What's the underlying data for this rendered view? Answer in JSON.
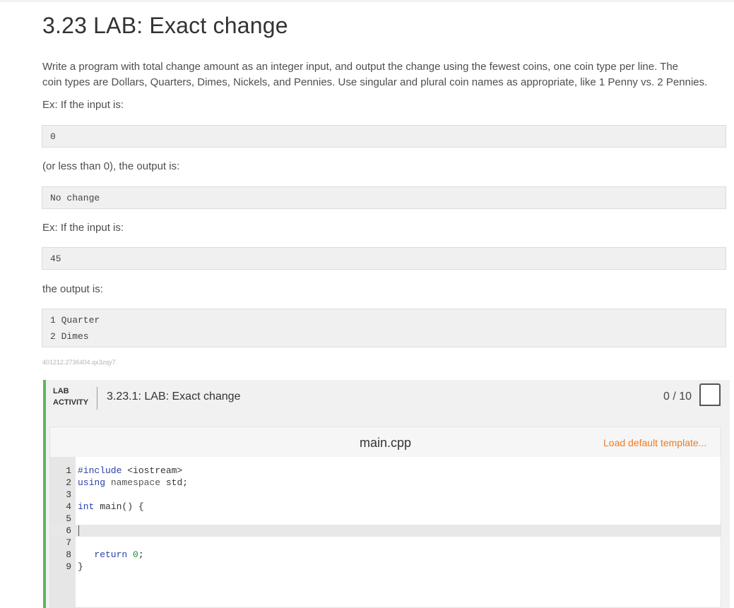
{
  "page": {
    "title": "3.23 LAB: Exact change",
    "description": "Write a program with total change amount as an integer input, and output the change using the fewest coins, one coin type per line. The coin types are Dollars, Quarters, Dimes, Nickels, and Pennies. Use singular and plural coin names as appropriate, like 1 Penny vs. 2 Pennies.",
    "description_line1": "Write a program with total change amount as an integer input, and output the change using the fewest coins, one coin type per line. The",
    "description_line2": "coin types are Dollars, Quarters, Dimes, Nickels, and Pennies. Use singular and plural coin names as appropriate, like 1 Penny vs. 2 Pennies.",
    "ex1_label": "Ex: If the input is:",
    "ex1_input": "0",
    "ex1_mid": "(or less than 0), the output is:",
    "ex1_output": "No change",
    "ex2_label": "Ex: If the input is:",
    "ex2_input": "45",
    "ex2_mid": "the output is:",
    "ex2_output": [
      "1 Quarter",
      "2 Dimes"
    ],
    "tag": "401212.2736404.qx3zqy7"
  },
  "lab": {
    "label_line1": "LAB",
    "label_line2": "ACTIVITY",
    "title": "3.23.1: LAB: Exact change",
    "score": "0 / 10"
  },
  "editor": {
    "filename": "main.cpp",
    "load_template_label": "Load default template...",
    "lines": [
      {
        "n": "1",
        "text": "#include <iostream>"
      },
      {
        "n": "2",
        "text": "using namespace std;"
      },
      {
        "n": "3",
        "text": ""
      },
      {
        "n": "4",
        "text": "int main() {"
      },
      {
        "n": "5",
        "text": ""
      },
      {
        "n": "6",
        "text": ""
      },
      {
        "n": "7",
        "text": ""
      },
      {
        "n": "8",
        "text": "   return 0;"
      },
      {
        "n": "9",
        "text": "}"
      }
    ],
    "active_line": 6
  }
}
